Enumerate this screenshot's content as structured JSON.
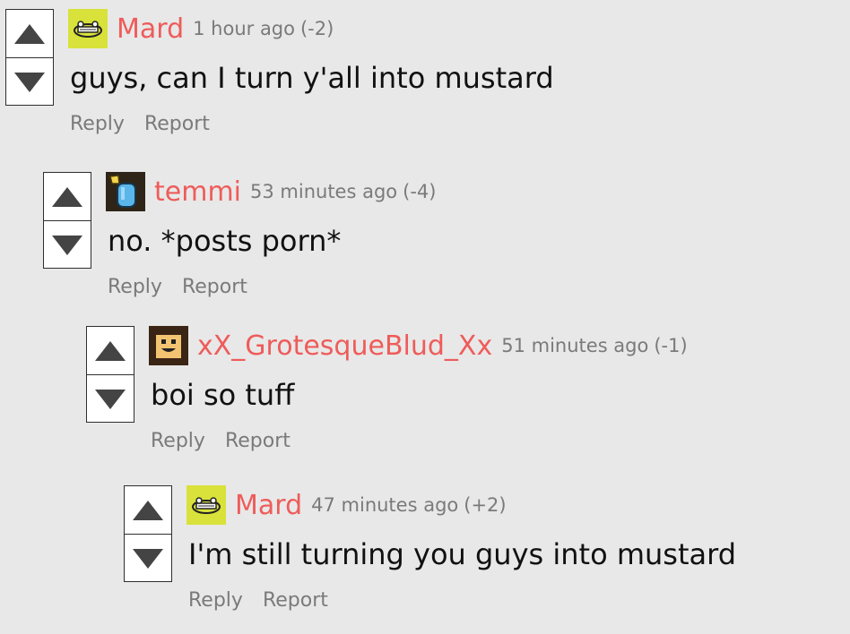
{
  "comments": [
    {
      "username": "Mard",
      "time": "1 hour ago",
      "score": "(-2)",
      "text": "guys, can I turn y'all into mustard",
      "reply": "Reply",
      "report": "Report",
      "avatar": "frog-avatar-icon"
    },
    {
      "username": "temmi",
      "time": "53 minutes ago",
      "score": "(-4)",
      "text": "no. *posts porn*",
      "reply": "Reply",
      "report": "Report",
      "avatar": "potion-avatar-icon"
    },
    {
      "username": "xX_GrotesqueBlud_Xx",
      "time": "51 minutes ago",
      "score": "(-1)",
      "text": "boi so tuff",
      "reply": "Reply",
      "report": "Report",
      "avatar": "face-avatar-icon"
    },
    {
      "username": "Mard",
      "time": "47 minutes ago",
      "score": "(+2)",
      "text": "I'm still turning you guys into mustard",
      "reply": "Reply",
      "report": "Report",
      "avatar": "frog-avatar-icon"
    }
  ],
  "colors": {
    "background": "#e8e8e8",
    "username": "#ee5c5a",
    "meta": "#7a7a7a",
    "text": "#111111"
  }
}
